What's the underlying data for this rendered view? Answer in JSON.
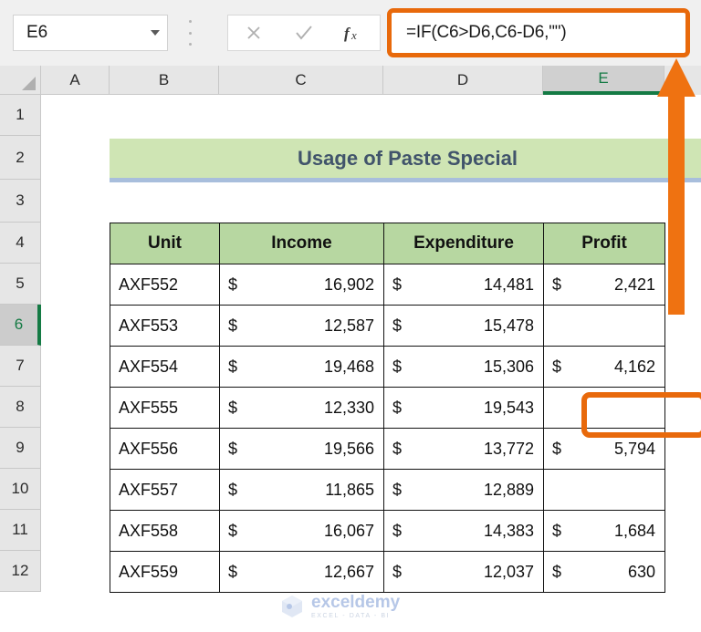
{
  "formula_bar": {
    "name_box_value": "E6",
    "name_box_chevron_icon": "chevron-down-icon",
    "drag_handle_icon": "vertical-dots-icon",
    "cancel_icon": "cancel-x-icon",
    "confirm_icon": "confirm-check-icon",
    "insert_function_icon": "fx-icon",
    "formula_value": "=IF(C6>D6,C6-D6,\"\")",
    "accent_color": "#e8690b"
  },
  "grid": {
    "select_all_icon": "select-all-triangle-icon",
    "column_headers": [
      "A",
      "B",
      "C",
      "D",
      "E"
    ],
    "selected_column": "E",
    "row_headers": [
      "1",
      "2",
      "3",
      "4",
      "5",
      "6",
      "7",
      "8",
      "9",
      "10",
      "11",
      "12"
    ],
    "selected_row": "6",
    "selection_color": "#147a44"
  },
  "sheet": {
    "title": "Usage of Paste Special",
    "title_bg_color": "#cfe5b4",
    "title_text_color": "#41546b",
    "header_bg_color": "#b7d7a1",
    "columns": [
      "Unit",
      "Income",
      "Expenditure",
      "Profit"
    ],
    "rows": [
      {
        "unit": "AXF552",
        "income_cur": "$",
        "income": "16,902",
        "exp_cur": "$",
        "expenditure": "14,481",
        "profit_cur": "$",
        "profit": "2,421"
      },
      {
        "unit": "AXF553",
        "income_cur": "$",
        "income": "12,587",
        "exp_cur": "$",
        "expenditure": "15,478",
        "profit_cur": "",
        "profit": ""
      },
      {
        "unit": "AXF554",
        "income_cur": "$",
        "income": "19,468",
        "exp_cur": "$",
        "expenditure": "15,306",
        "profit_cur": "$",
        "profit": "4,162"
      },
      {
        "unit": "AXF555",
        "income_cur": "$",
        "income": "12,330",
        "exp_cur": "$",
        "expenditure": "19,543",
        "profit_cur": "",
        "profit": ""
      },
      {
        "unit": "AXF556",
        "income_cur": "$",
        "income": "19,566",
        "exp_cur": "$",
        "expenditure": "13,772",
        "profit_cur": "$",
        "profit": "5,794"
      },
      {
        "unit": "AXF557",
        "income_cur": "$",
        "income": "11,865",
        "exp_cur": "$",
        "expenditure": "12,889",
        "profit_cur": "",
        "profit": ""
      },
      {
        "unit": "AXF558",
        "income_cur": "$",
        "income": "16,067",
        "exp_cur": "$",
        "expenditure": "14,383",
        "profit_cur": "$",
        "profit": "1,684"
      },
      {
        "unit": "AXF559",
        "income_cur": "$",
        "income": "12,667",
        "exp_cur": "$",
        "expenditure": "12,037",
        "profit_cur": "$",
        "profit": "630"
      }
    ]
  },
  "annotation": {
    "highlighted_cell": "E6",
    "arrow_icon": "up-arrow-callout-icon",
    "arrow_color": "#e8690b"
  },
  "watermark": {
    "logo_icon": "exceldemy-hexagon-logo-icon",
    "name": "exceldemy",
    "tagline": "EXCEL - DATA - BI"
  }
}
